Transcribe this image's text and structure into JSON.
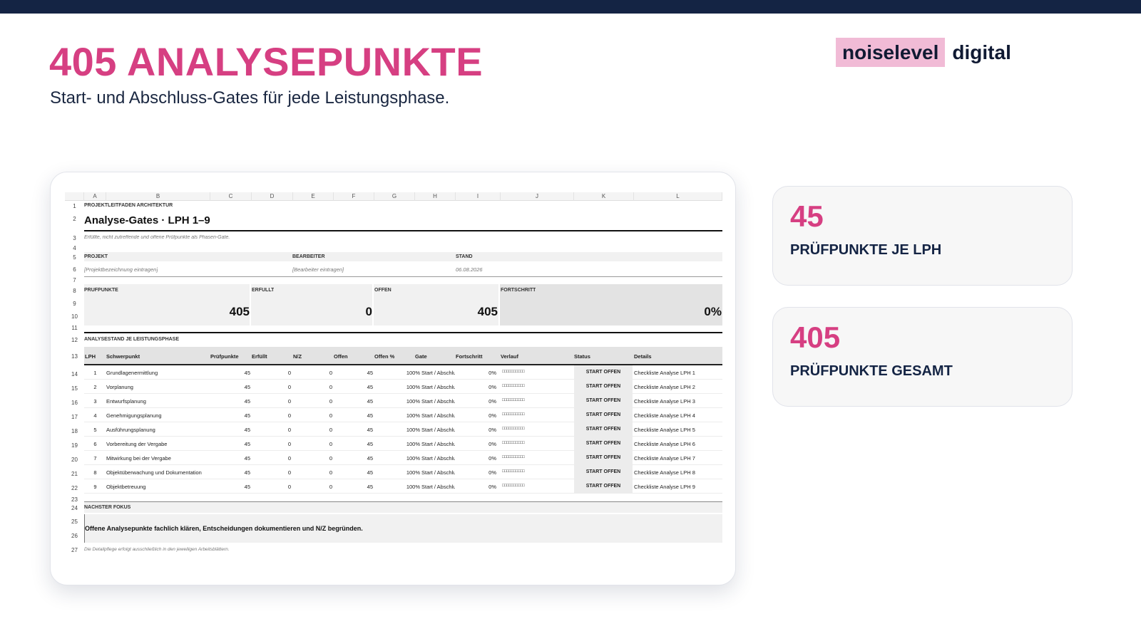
{
  "header": {
    "title": "405 ANALYSEPUNKTE",
    "subtitle": "Start- und Abschluss-Gates für jede Leistungsphase."
  },
  "brand": {
    "highlight": "noiselevel",
    "rest": "digital"
  },
  "sheet": {
    "columns": [
      "A",
      "B",
      "C",
      "D",
      "E",
      "F",
      "G",
      "H",
      "I",
      "J",
      "K",
      "L"
    ],
    "row_numbers": [
      "1",
      "2",
      "3",
      "4",
      "5",
      "6",
      "7",
      "8",
      "9",
      "10",
      "11",
      "12",
      "13",
      "14",
      "15",
      "16",
      "17",
      "18",
      "19",
      "20",
      "21",
      "22",
      "23",
      "24",
      "25",
      "26",
      "27"
    ],
    "kicker": "PROJEKTLEITFADEN ARCHITEKTUR",
    "title": "Analyse-Gates · LPH 1–9",
    "note": "Erfüllte, nicht zutreffende und offene Prüfpunkte als Phasen-Gate.",
    "meta": {
      "project_label": "PROJEKT",
      "project_value": "[Projektbezeichnung eintragen]",
      "editor_label": "BEARBEITER",
      "editor_value": "[Bearbeiter eintragen]",
      "date_label": "STAND",
      "date_value": "06.08.2026"
    },
    "kpis": {
      "pruefpunkte_label": "PRÜFPUNKTE",
      "pruefpunkte_value": "405",
      "erfuellt_label": "ERFÜLLT",
      "erfuellt_value": "0",
      "offen_label": "OFFEN",
      "offen_value": "405",
      "fortschritt_label": "FORTSCHRITT",
      "fortschritt_value": "0%"
    },
    "section_title": "ANALYSESTAND JE LEISTUNGSPHASE",
    "table_headers": {
      "lph": "LPH",
      "schwerpunkt": "Schwerpunkt",
      "pruefpunkte": "Prüfpunkte",
      "erfuellt": "Erfüllt",
      "nz": "N/Z",
      "offen": "Offen",
      "offen_pct": "Offen %",
      "gate": "Gate",
      "fortschritt": "Fortschritt",
      "verlauf": "Verlauf",
      "status": "Status",
      "details": "Details"
    },
    "rows": [
      {
        "lph": "1",
        "schwerpunkt": "Grundlagenermittlung",
        "pruefpunkte": "45",
        "erfuellt": "0",
        "nz": "0",
        "offen": "45",
        "offen_pct": "100%",
        "gate": "Start / Abschluss",
        "fortschritt": "0%",
        "verlauf": "□□□□□□□□□□",
        "status": "START OFFEN",
        "details": "Checkliste Analyse LPH 1"
      },
      {
        "lph": "2",
        "schwerpunkt": "Vorplanung",
        "pruefpunkte": "45",
        "erfuellt": "0",
        "nz": "0",
        "offen": "45",
        "offen_pct": "100%",
        "gate": "Start / Abschluss",
        "fortschritt": "0%",
        "verlauf": "□□□□□□□□□□",
        "status": "START OFFEN",
        "details": "Checkliste Analyse LPH 2"
      },
      {
        "lph": "3",
        "schwerpunkt": "Entwurfsplanung",
        "pruefpunkte": "45",
        "erfuellt": "0",
        "nz": "0",
        "offen": "45",
        "offen_pct": "100%",
        "gate": "Start / Abschluss",
        "fortschritt": "0%",
        "verlauf": "□□□□□□□□□□",
        "status": "START OFFEN",
        "details": "Checkliste Analyse LPH 3"
      },
      {
        "lph": "4",
        "schwerpunkt": "Genehmigungsplanung",
        "pruefpunkte": "45",
        "erfuellt": "0",
        "nz": "0",
        "offen": "45",
        "offen_pct": "100%",
        "gate": "Start / Abschluss",
        "fortschritt": "0%",
        "verlauf": "□□□□□□□□□□",
        "status": "START OFFEN",
        "details": "Checkliste Analyse LPH 4"
      },
      {
        "lph": "5",
        "schwerpunkt": "Ausführungsplanung",
        "pruefpunkte": "45",
        "erfuellt": "0",
        "nz": "0",
        "offen": "45",
        "offen_pct": "100%",
        "gate": "Start / Abschluss",
        "fortschritt": "0%",
        "verlauf": "□□□□□□□□□□",
        "status": "START OFFEN",
        "details": "Checkliste Analyse LPH 5"
      },
      {
        "lph": "6",
        "schwerpunkt": "Vorbereitung der Vergabe",
        "pruefpunkte": "45",
        "erfuellt": "0",
        "nz": "0",
        "offen": "45",
        "offen_pct": "100%",
        "gate": "Start / Abschluss",
        "fortschritt": "0%",
        "verlauf": "□□□□□□□□□□",
        "status": "START OFFEN",
        "details": "Checkliste Analyse LPH 6"
      },
      {
        "lph": "7",
        "schwerpunkt": "Mitwirkung bei der Vergabe",
        "pruefpunkte": "45",
        "erfuellt": "0",
        "nz": "0",
        "offen": "45",
        "offen_pct": "100%",
        "gate": "Start / Abschluss",
        "fortschritt": "0%",
        "verlauf": "□□□□□□□□□□",
        "status": "START OFFEN",
        "details": "Checkliste Analyse LPH 7"
      },
      {
        "lph": "8",
        "schwerpunkt": "Objektüberwachung und Dokumentation",
        "pruefpunkte": "45",
        "erfuellt": "0",
        "nz": "0",
        "offen": "45",
        "offen_pct": "100%",
        "gate": "Start / Abschluss",
        "fortschritt": "0%",
        "verlauf": "□□□□□□□□□□",
        "status": "START OFFEN",
        "details": "Checkliste Analyse LPH 8"
      },
      {
        "lph": "9",
        "schwerpunkt": "Objektbetreuung",
        "pruefpunkte": "45",
        "erfuellt": "0",
        "nz": "0",
        "offen": "45",
        "offen_pct": "100%",
        "gate": "Start / Abschluss",
        "fortschritt": "0%",
        "verlauf": "□□□□□□□□□□",
        "status": "START OFFEN",
        "details": "Checkliste Analyse LPH 9"
      }
    ],
    "focus_label": "NÄCHSTER FOKUS",
    "focus_text": "Offene Analysepunkte fachlich klären, Entscheidungen dokumentieren und N/Z begründen.",
    "footnote": "Die Detailpflege erfolgt ausschließlich in den jeweiligen Arbeitsblättern."
  },
  "stats": [
    {
      "value": "45",
      "label": "PRÜFPUNKTE JE LPH"
    },
    {
      "value": "405",
      "label": "PRÜFPUNKTE GESAMT"
    }
  ],
  "colors": {
    "accent": "#d63f82",
    "navy": "#142444",
    "brand_highlight": "#f1bbd6"
  }
}
